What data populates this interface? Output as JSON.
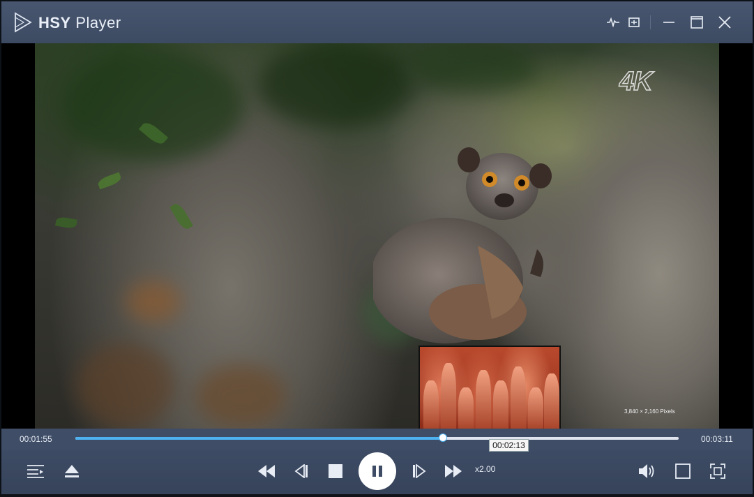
{
  "window": {
    "title_bold": "HSY",
    "title_rest": " Player"
  },
  "titlebar": {
    "icons": [
      "logo-play-icon",
      "waveform-icon",
      "screen-capture-icon",
      "minimize-icon",
      "maximize-icon",
      "close-icon"
    ]
  },
  "video": {
    "badge": "4K",
    "resolution_text": "3,840 × 2,160 Pixels"
  },
  "progress": {
    "current_time": "00:01:55",
    "total_time": "00:03:11",
    "hover_time": "00:02:13",
    "played_fraction": 0.609
  },
  "controls": {
    "speed_label": "x2.00",
    "icons": [
      "playlist-icon",
      "eject-icon",
      "rewind-icon",
      "previous-frame-icon",
      "stop-icon",
      "pause-icon",
      "next-frame-icon",
      "fast-forward-icon",
      "volume-icon",
      "window-mode-icon",
      "fullscreen-icon"
    ]
  },
  "colors": {
    "accent": "#4fb2f0",
    "bar": "#3d4b64"
  }
}
